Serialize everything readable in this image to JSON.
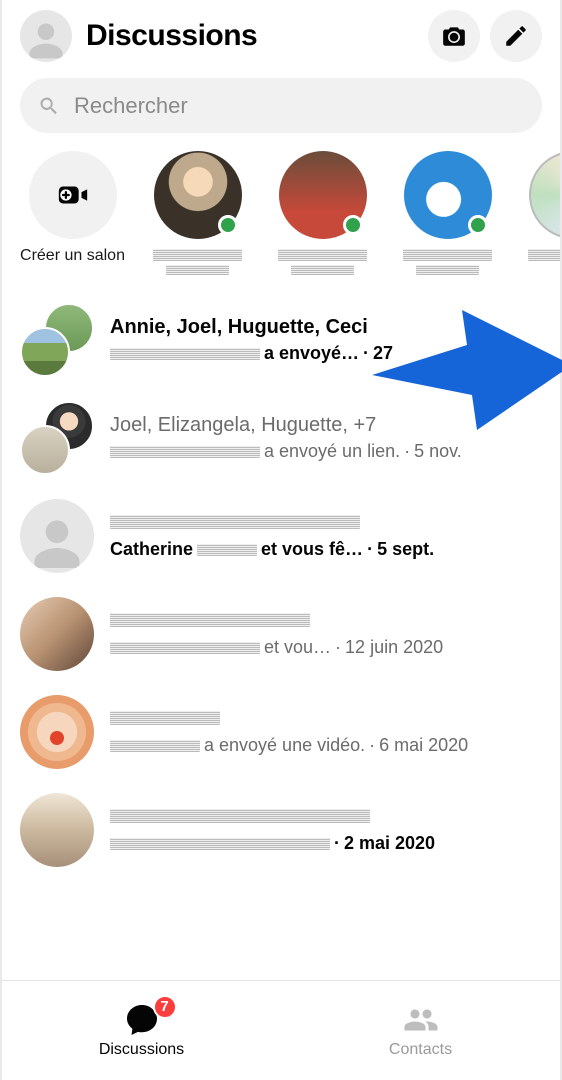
{
  "header": {
    "title": "Discussions"
  },
  "search": {
    "placeholder": "Rechercher"
  },
  "stories": {
    "create_label": "Créer un salon"
  },
  "conversations": [
    {
      "title": "Annie, Joel, Huguette, Ceci",
      "bold": true,
      "sub_text": "a envoyé…",
      "sub_date": "27",
      "sub_bold": true
    },
    {
      "title": "Joel, Elizangela, Huguette, +7",
      "bold": false,
      "sub_text": "a envoyé un lien.",
      "sub_date": "5 nov.",
      "sub_bold": false
    },
    {
      "title": "",
      "bold": false,
      "sub_prefix": "Catherine",
      "sub_text": "et vous fê…",
      "sub_date": "5 sept.",
      "sub_bold": true
    },
    {
      "title": "",
      "bold": false,
      "sub_text": "et vou…",
      "sub_date": "12 juin 2020",
      "sub_bold": false
    },
    {
      "title": "",
      "bold": false,
      "sub_text": "a envoyé une vidéo.",
      "sub_date": "6 mai 2020",
      "sub_bold": false
    },
    {
      "title": "",
      "bold": false,
      "sub_text": "",
      "sub_date": "2 mai 2020",
      "sub_bold": true
    }
  ],
  "tabs": {
    "discussions": "Discussions",
    "contacts": "Contacts",
    "badge": "7"
  }
}
